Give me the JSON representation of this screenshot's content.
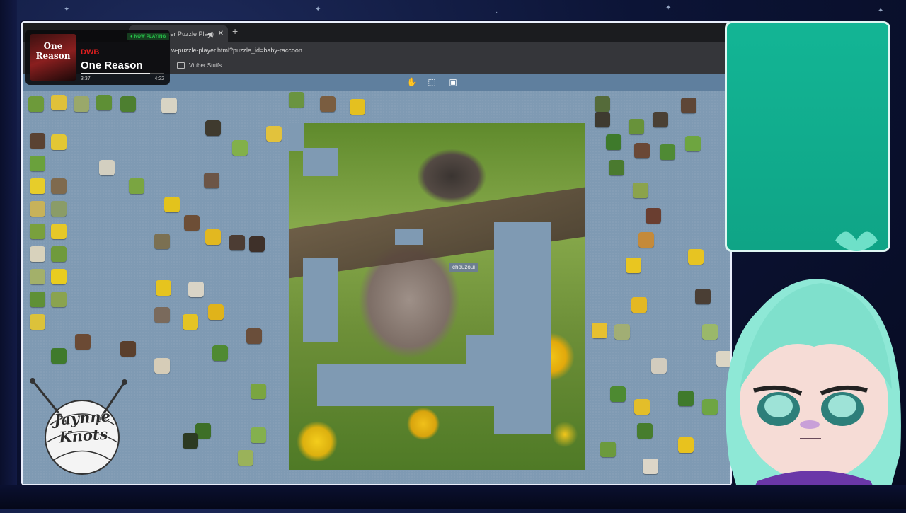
{
  "browser": {
    "tab_title": "zer Puzzle Play",
    "tab_sound_icon": "speaker-icon",
    "tab_close": "✕",
    "new_tab": "+",
    "url": "w-puzzle-player.html?puzzle_id=baby-raccoon",
    "bookmark_label": "Vtuber Stuffs"
  },
  "toolbar": {
    "icons": [
      "hand-icon",
      "select-region-icon",
      "image-preview-icon"
    ]
  },
  "puzzle": {
    "cursor_label": "chouzoui"
  },
  "music": {
    "album_title": "One Reason",
    "badge": "● NOW PLAYING",
    "artist": "DWB",
    "song": "One Reason",
    "time_current": "3:37",
    "time_total": "4:22",
    "progress": 0.83
  },
  "logo": {
    "text": "Jaynne Knots"
  },
  "colors": {
    "board": "#7f9ab3",
    "toolbar": "#5f7f9e",
    "accent_teal": "#13b595",
    "now_playing_green": "#29d14f",
    "artist_red": "#e01e1e"
  }
}
